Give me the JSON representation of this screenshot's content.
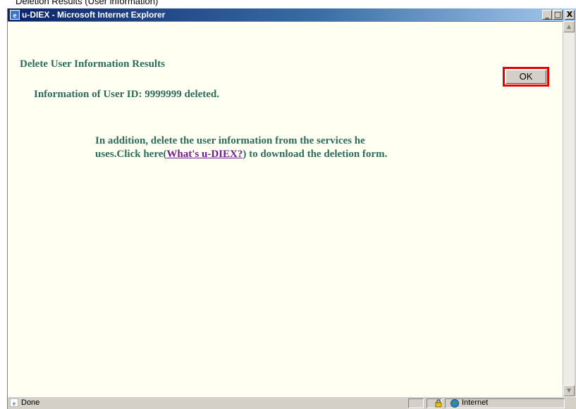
{
  "caption": "Deletion Results (User information)",
  "window": {
    "title": "u-DIEX - Microsoft Internet Explorer",
    "minimize": "_",
    "maximize": "□",
    "close": "X"
  },
  "content": {
    "heading": "Delete User Information Results",
    "ok_label": "OK",
    "deleted_message": "Information of User ID: 9999999 deleted.",
    "additional_line1": "In addition, delete the user information from the services he",
    "additional_line2_prefix": "uses.Click here(",
    "link_text": "What's u-DIEX?",
    "additional_line2_suffix": ") to download the deletion form.",
    "link_color": "#6b1f8f",
    "text_color": "#2e6b5a"
  },
  "statusbar": {
    "status": "Done",
    "zone": "Internet"
  },
  "colors": {
    "highlight": "#e00000",
    "page_background": "#fffff2"
  }
}
